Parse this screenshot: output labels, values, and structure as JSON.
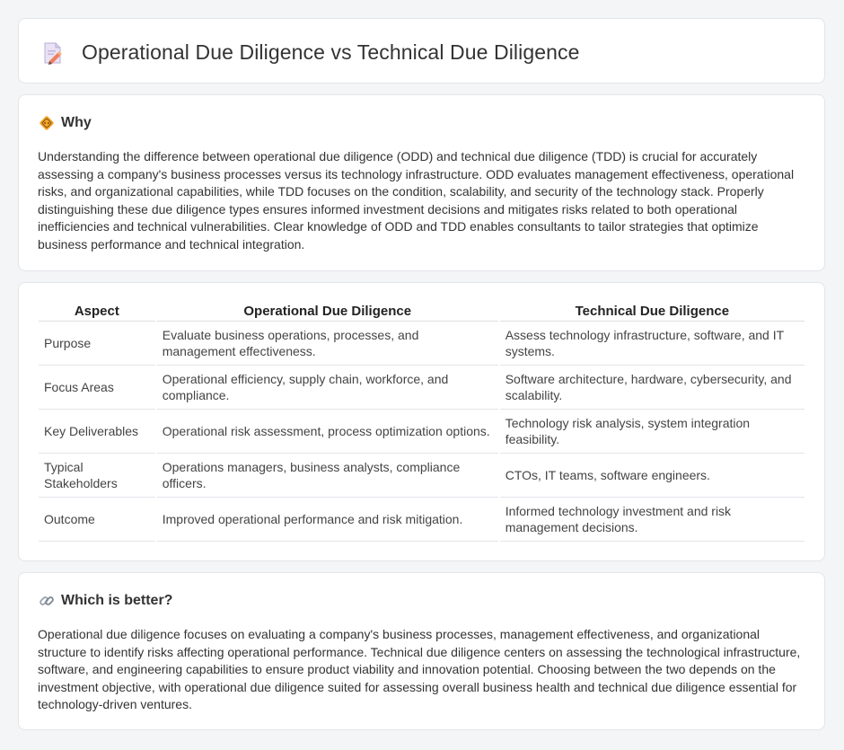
{
  "header": {
    "title": "Operational Due Diligence vs Technical Due Diligence",
    "icon": "document-pencil-icon"
  },
  "why": {
    "icon": "diamond-sign-icon",
    "heading": "Why",
    "body": "Understanding the difference between operational due diligence (ODD) and technical due diligence (TDD) is crucial for accurately assessing a company's business processes versus its technology infrastructure. ODD evaluates management effectiveness, operational risks, and organizational capabilities, while TDD focuses on the condition, scalability, and security of the technology stack. Properly distinguishing these due diligence types ensures informed investment decisions and mitigates risks related to both operational inefficiencies and technical vulnerabilities. Clear knowledge of ODD and TDD enables consultants to tailor strategies that optimize business performance and technical integration."
  },
  "table": {
    "headers": [
      "Aspect",
      "Operational Due Diligence",
      "Technical Due Diligence"
    ],
    "rows": [
      [
        "Purpose",
        "Evaluate business operations, processes, and management effectiveness.",
        "Assess technology infrastructure, software, and IT systems."
      ],
      [
        "Focus Areas",
        "Operational efficiency, supply chain, workforce, and compliance.",
        "Software architecture, hardware, cybersecurity, and scalability."
      ],
      [
        "Key Deliverables",
        "Operational risk assessment, process optimization options.",
        "Technology risk analysis, system integration feasibility."
      ],
      [
        "Typical Stakeholders",
        "Operations managers, business analysts, compliance officers.",
        "CTOs, IT teams, software engineers."
      ],
      [
        "Outcome",
        "Improved operational performance and risk mitigation.",
        "Informed technology investment and risk management decisions."
      ]
    ]
  },
  "better": {
    "icon": "link-icon",
    "heading": "Which is better?",
    "body": "Operational due diligence focuses on evaluating a company's business processes, management effectiveness, and organizational structure to identify risks affecting operational performance. Technical due diligence centers on assessing the technological infrastructure, software, and engineering capabilities to ensure product viability and innovation potential. Choosing between the two depends on the investment objective, with operational due diligence suited for assessing overall business health and technical due diligence essential for technology-driven ventures."
  }
}
